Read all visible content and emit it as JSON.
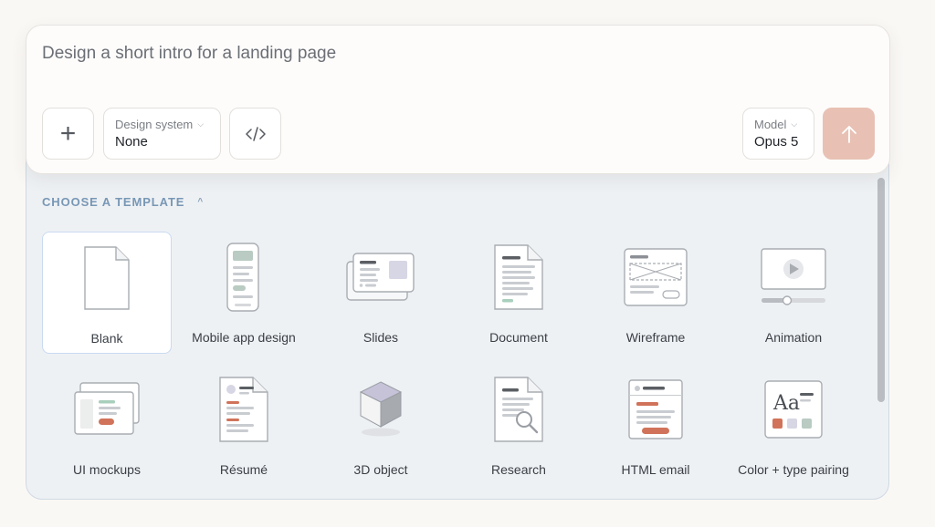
{
  "prompt": {
    "text": "Design a short intro for a landing page"
  },
  "toolbar": {
    "design_system_label": "Design system",
    "design_system_value": "None",
    "model_label": "Model",
    "model_value": "Opus 5"
  },
  "templates": {
    "heading": "CHOOSE A TEMPLATE",
    "items": [
      {
        "label": "Blank",
        "icon": "blank-page-icon",
        "selected": true
      },
      {
        "label": "Mobile app design",
        "icon": "mobile-phone-icon"
      },
      {
        "label": "Slides",
        "icon": "slides-icon"
      },
      {
        "label": "Document",
        "icon": "document-icon"
      },
      {
        "label": "Wireframe",
        "icon": "wireframe-icon"
      },
      {
        "label": "Animation",
        "icon": "animation-icon"
      },
      {
        "label": "UI mockups",
        "icon": "ui-mockups-icon"
      },
      {
        "label": "Résumé",
        "icon": "resume-icon"
      },
      {
        "label": "3D object",
        "icon": "cube-icon"
      },
      {
        "label": "Research",
        "icon": "research-magnifier-icon"
      },
      {
        "label": "HTML email",
        "icon": "email-icon"
      },
      {
        "label": "Color + type pairing",
        "icon": "color-type-icon"
      }
    ]
  },
  "colors": {
    "accent_send": "#e8c1b4",
    "heading": "#7897b5",
    "panel_bg": "#eef1f4",
    "highlight_red": "#d0735a",
    "highlight_green": "#a9cfbd"
  }
}
